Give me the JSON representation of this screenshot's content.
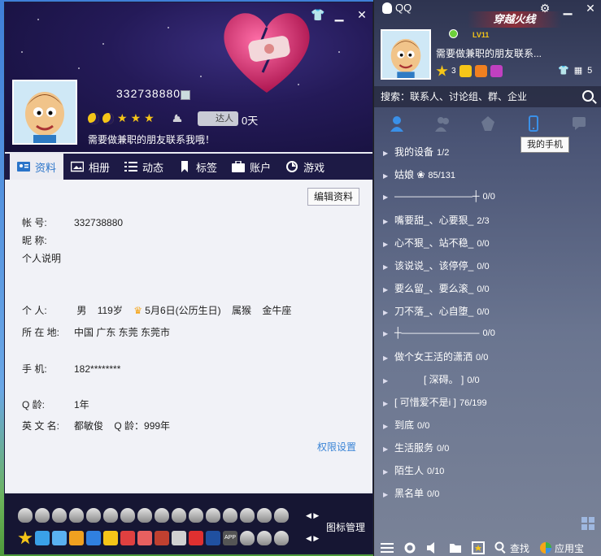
{
  "profile": {
    "qq_number": "332738880",
    "days": "0天",
    "daren_label": "达人",
    "signature": "需要做兼职的朋友联系我哦！",
    "tabs": [
      {
        "label": "资料",
        "icon": "card-icon"
      },
      {
        "label": "相册",
        "icon": "photo-icon"
      },
      {
        "label": "动态",
        "icon": "feed-icon"
      },
      {
        "label": "标签",
        "icon": "tag-icon"
      },
      {
        "label": "账户",
        "icon": "wallet-icon"
      },
      {
        "label": "游戏",
        "icon": "game-icon"
      }
    ],
    "edit_label": "编辑资料",
    "fields": {
      "account_k": "帐    号:",
      "account_v": "332738880",
      "nick_k": "昵    称:",
      "desc_k": "个人说明",
      "person_k": "个    人:",
      "person_v1": "男",
      "person_v2": "119岁",
      "person_v3": "5月6日(公历生日)",
      "person_v4": "属猴",
      "person_v5": "金牛座",
      "loc_k": "所 在 地:",
      "loc_v": "中国 广东 东莞 东莞市",
      "phone_k": "手    机:",
      "phone_v": "182********",
      "qage_k": "Q    龄:",
      "qage_v": "1年",
      "en_k": "英 文 名:",
      "en_v": "都敏俊",
      "qage2_v": "Q 龄：999年"
    },
    "perm_label": "权限设置",
    "icon_mgr_label": "图标管理"
  },
  "main": {
    "title": "QQ",
    "brand": "穿越火线",
    "level_tag": "LV11",
    "signature": "需要做兼职的朋友联系...",
    "badge_count1": "3",
    "badge_count2": "5",
    "search_placeholder": "搜索：联系人、讨论组、群、企业",
    "tooltip": "我的手机",
    "groups": [
      {
        "name": "我的设备",
        "count": "1/2"
      },
      {
        "name": "姑娘 ❀",
        "count": "85/131"
      },
      {
        "name": "————————┼",
        "count": "0/0"
      },
      {
        "name": "嘴要甜_、心要狠_",
        "count": "2/3"
      },
      {
        "name": "心不狠_、站不稳_",
        "count": "0/0"
      },
      {
        "name": "该说说_、该停停_",
        "count": "0/0"
      },
      {
        "name": "要么留_、要么滚_",
        "count": "0/0"
      },
      {
        "name": "刀不落_、心自堕_",
        "count": "0/0"
      },
      {
        "name": "┼————————",
        "count": "0/0"
      },
      {
        "name": "做个女王活的潇洒",
        "count": "0/0"
      },
      {
        "name": "　　　[ 深碍。 ]",
        "count": "0/0"
      },
      {
        "name": "[ 可惜爱不是i ]",
        "count": "76/199"
      },
      {
        "name": "到底",
        "count": "0/0"
      },
      {
        "name": "生活服务",
        "count": "0/0"
      },
      {
        "name": "陌生人",
        "count": "0/10"
      },
      {
        "name": "黑名单",
        "count": "0/0"
      }
    ],
    "find_label": "查找",
    "app_label": "应用宝"
  }
}
